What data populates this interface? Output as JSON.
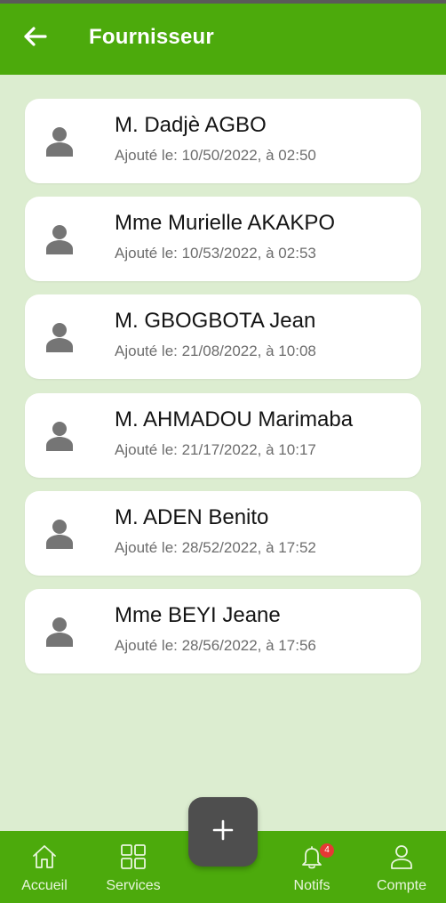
{
  "header": {
    "title": "Fournisseur",
    "back_icon": "arrow-left-icon",
    "background": "#4caa0c"
  },
  "suppliers": [
    {
      "name": "M. Dadjè AGBO",
      "added": "Ajouté le: 10/50/2022, à 02:50"
    },
    {
      "name": "Mme Murielle AKAKPO",
      "added": "Ajouté le: 10/53/2022, à 02:53"
    },
    {
      "name": "M. GBOGBOTA Jean",
      "added": "Ajouté le: 21/08/2022, à 10:08"
    },
    {
      "name": "M. AHMADOU Marimaba",
      "added": "Ajouté le: 21/17/2022, à 10:17"
    },
    {
      "name": "M. ADEN Benito",
      "added": "Ajouté le: 28/52/2022, à 17:52"
    },
    {
      "name": "Mme BEYI Jeane",
      "added": "Ajouté le: 28/56/2022, à 17:56"
    }
  ],
  "fab": {
    "icon": "plus-icon"
  },
  "bottom_nav": [
    {
      "label": "Accueil",
      "icon": "home-icon"
    },
    {
      "label": "Services",
      "icon": "grid-icon"
    },
    {
      "label": "Notifs",
      "icon": "bell-icon",
      "badge": "4"
    },
    {
      "label": "Compte",
      "icon": "user-icon"
    }
  ],
  "colors": {
    "primary": "#4caa0c",
    "background": "#dcedd0",
    "fab": "#4e4e4e",
    "badge": "#e53935"
  }
}
